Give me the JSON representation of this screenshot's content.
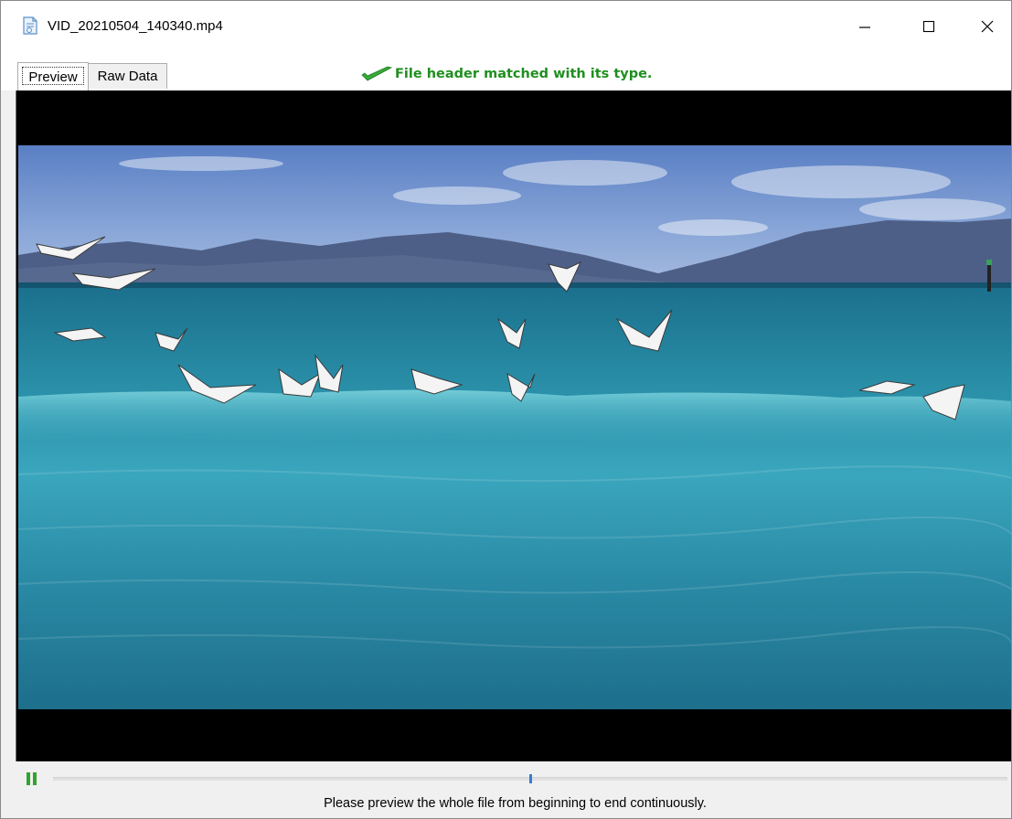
{
  "window": {
    "title": "VID_20210504_140340.mp4",
    "icon": "document-icon",
    "buttons": [
      "minimize-icon",
      "maximize-icon",
      "close-icon"
    ]
  },
  "tabs": [
    {
      "label": "Preview",
      "selected": true
    },
    {
      "label": "Raw Data",
      "selected": false
    }
  ],
  "status": {
    "text": "File header matched with its type.",
    "icon": "checkmark-icon",
    "color": "#1f8f1f"
  },
  "player": {
    "state": "playing",
    "control_icon": "pause-icon",
    "progress_fraction": 0.5,
    "accent_color": "#2f7fd3"
  },
  "hint": "Please preview the whole file from beginning to end continuously."
}
